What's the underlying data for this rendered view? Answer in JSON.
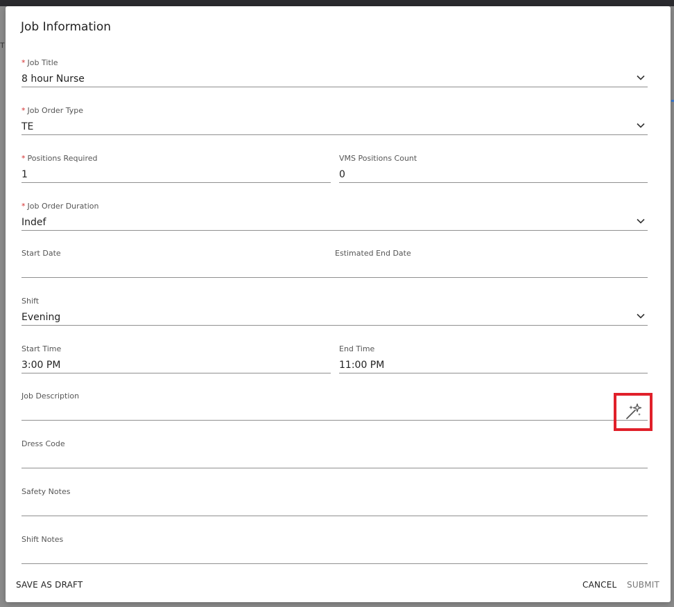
{
  "dialog": {
    "title": "Job Information"
  },
  "fields": {
    "job_title": {
      "label": "Job Title",
      "value": "8 hour Nurse",
      "required": true
    },
    "job_order_type": {
      "label": "Job Order Type",
      "value": "TE",
      "required": true
    },
    "positions_required": {
      "label": "Positions Required",
      "value": "1",
      "required": true
    },
    "vms_positions_count": {
      "label": "VMS Positions Count",
      "value": "0"
    },
    "job_order_duration": {
      "label": "Job Order Duration",
      "value": "Indef",
      "required": true
    },
    "start_date": {
      "label": "Start Date",
      "value": ""
    },
    "estimated_end_date": {
      "label": "Estimated End Date",
      "value": ""
    },
    "shift": {
      "label": "Shift",
      "value": "Evening"
    },
    "start_time": {
      "label": "Start Time",
      "value": "3:00 PM"
    },
    "end_time": {
      "label": "End Time",
      "value": "11:00 PM"
    },
    "job_description": {
      "label": "Job Description",
      "value": ""
    },
    "dress_code": {
      "label": "Dress Code",
      "value": ""
    },
    "safety_notes": {
      "label": "Safety Notes",
      "value": ""
    },
    "shift_notes": {
      "label": "Shift Notes",
      "value": ""
    }
  },
  "required_marker": "*",
  "footer": {
    "save_draft": "SAVE AS DRAFT",
    "cancel": "CANCEL",
    "submit": "SUBMIT"
  },
  "backdrop": {
    "edge_text": "TE"
  },
  "icons": {
    "dropdown": "chevron-down-icon",
    "ai_generate": "magic-wand-icon"
  },
  "colors": {
    "required": "#d32f2f",
    "highlight_box": "#e0202a",
    "underline": "#8f8f8f"
  }
}
